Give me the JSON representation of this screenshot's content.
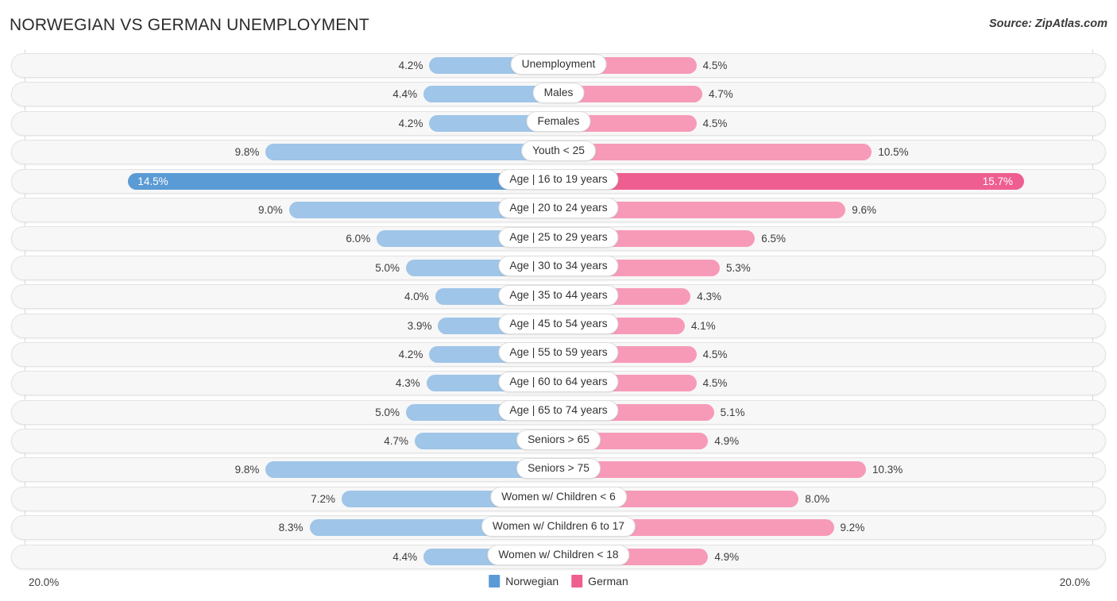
{
  "header": {
    "title": "NORWEGIAN VS GERMAN UNEMPLOYMENT",
    "source": "Source: ZipAtlas.com"
  },
  "footer": {
    "axis_left": "20.0%",
    "axis_right": "20.0%",
    "legend": [
      {
        "label": "Norwegian",
        "color": "#5b9bd5"
      },
      {
        "label": "German",
        "color": "#ef5e91"
      }
    ]
  },
  "colors": {
    "norwegian": "#9fc5e8",
    "german": "#f79ab8",
    "norwegian_highlight": "#5b9bd5",
    "german_highlight": "#ef5e91",
    "track": "#f7f7f7",
    "track_border": "#e3e3e3"
  },
  "chart_data": {
    "type": "bar",
    "title": "NORWEGIAN VS GERMAN UNEMPLOYMENT",
    "subtitle": "Source: ZipAtlas.com",
    "orientation": "horizontal-diverging",
    "xlabel": "",
    "ylabel": "",
    "xlim": [
      20.0,
      20.0
    ],
    "axis_max": 20.0,
    "grid": false,
    "legend_position": "bottom-center",
    "categories": [
      "Unemployment",
      "Males",
      "Females",
      "Youth < 25",
      "Age | 16 to 19 years",
      "Age | 20 to 24 years",
      "Age | 25 to 29 years",
      "Age | 30 to 34 years",
      "Age | 35 to 44 years",
      "Age | 45 to 54 years",
      "Age | 55 to 59 years",
      "Age | 60 to 64 years",
      "Age | 65 to 74 years",
      "Seniors > 65",
      "Seniors > 75",
      "Women w/ Children < 6",
      "Women w/ Children 6 to 17",
      "Women w/ Children < 18"
    ],
    "series": [
      {
        "name": "Norwegian",
        "side": "left",
        "values": [
          4.2,
          4.4,
          4.2,
          9.8,
          14.5,
          9.0,
          6.0,
          5.0,
          4.0,
          3.9,
          4.2,
          4.3,
          5.0,
          4.7,
          9.8,
          7.2,
          8.3,
          4.4
        ],
        "labels": [
          "4.2%",
          "4.4%",
          "4.2%",
          "9.8%",
          "14.5%",
          "9.0%",
          "6.0%",
          "5.0%",
          "4.0%",
          "3.9%",
          "4.2%",
          "4.3%",
          "5.0%",
          "4.7%",
          "9.8%",
          "7.2%",
          "8.3%",
          "4.4%"
        ]
      },
      {
        "name": "German",
        "side": "right",
        "values": [
          4.5,
          4.7,
          4.5,
          10.5,
          15.7,
          9.6,
          6.5,
          5.3,
          4.3,
          4.1,
          4.5,
          4.5,
          5.1,
          4.9,
          10.3,
          8.0,
          9.2,
          4.9
        ],
        "labels": [
          "4.5%",
          "4.7%",
          "4.5%",
          "10.5%",
          "15.7%",
          "9.6%",
          "6.5%",
          "5.3%",
          "4.3%",
          "4.1%",
          "4.5%",
          "4.5%",
          "5.1%",
          "4.9%",
          "10.3%",
          "8.0%",
          "9.2%",
          "4.9%"
        ]
      }
    ],
    "highlighted_row": "Age | 16 to 19 years"
  }
}
